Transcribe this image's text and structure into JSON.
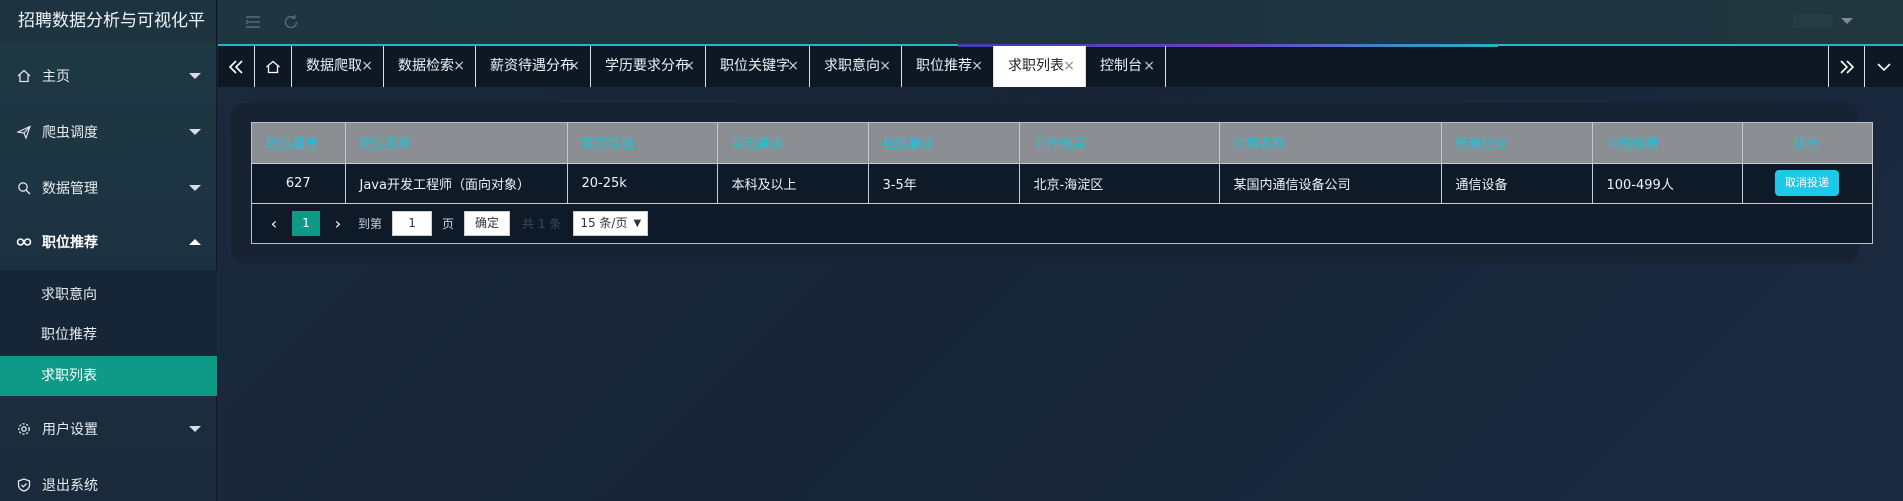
{
  "app": {
    "title": "招聘数据分析与可视化平"
  },
  "sidebar": {
    "items": [
      {
        "label": "主页",
        "icon": "home-icon"
      },
      {
        "label": "爬虫调度",
        "icon": "send-icon"
      },
      {
        "label": "数据管理",
        "icon": "search-icon"
      },
      {
        "label": "职位推荐",
        "icon": "link-icon"
      },
      {
        "label": "用户设置",
        "icon": "gear-icon"
      },
      {
        "label": "退出系统",
        "icon": "shield-icon"
      }
    ],
    "submenu": [
      {
        "label": "求职意向"
      },
      {
        "label": "职位推荐"
      },
      {
        "label": "求职列表"
      }
    ]
  },
  "tabs": [
    {
      "label": "数据爬取"
    },
    {
      "label": "数据检索"
    },
    {
      "label": "薪资待遇分布"
    },
    {
      "label": "学历要求分布"
    },
    {
      "label": "职位关键字"
    },
    {
      "label": "求职意向"
    },
    {
      "label": "职位推荐"
    },
    {
      "label": "求职列表"
    },
    {
      "label": "控制台"
    }
  ],
  "table": {
    "headers": [
      "职位编号",
      "职位名称",
      "薪资待遇",
      "学历要求",
      "经验要求",
      "工作地点",
      "公司名称",
      "所属行业",
      "公司规模",
      "操作"
    ],
    "rows": [
      {
        "id": "627",
        "name": "Java开发工程师（面向对象）",
        "salary": "20-25k",
        "education": "本科及以上",
        "experience": "3-5年",
        "location": "北京-海淀区",
        "company": "某国内通信设备公司",
        "industry": "通信设备",
        "size": "100-499人",
        "action": "取消投递"
      }
    ]
  },
  "pager": {
    "current_page": "1",
    "jump_label": "到第",
    "jump_value": "1",
    "page_label": "页",
    "confirm_label": "确定",
    "total_label": "共 1 条",
    "page_size": "15 条/页"
  },
  "colors": {
    "accent": "#0e9a86",
    "header_text": "#19c6dd",
    "button": "#1ec8e8"
  }
}
